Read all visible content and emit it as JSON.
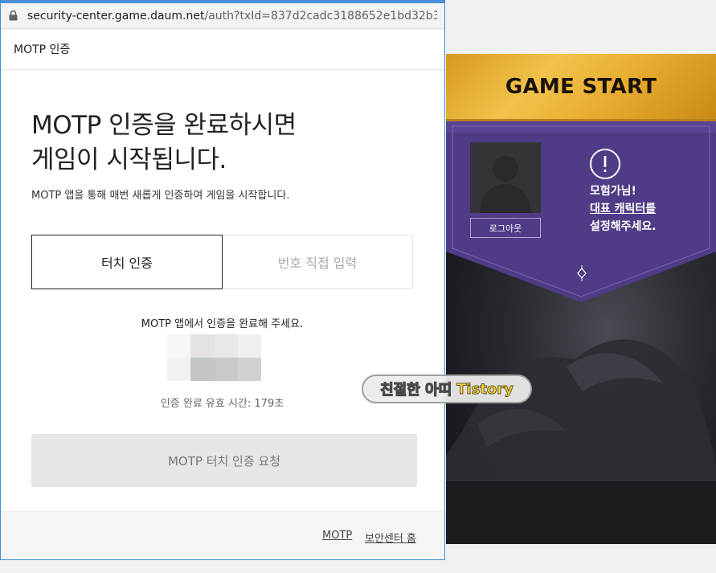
{
  "browser": {
    "url_host": "security-center.game.daum.net",
    "url_path": "/auth?txId=837d2cadc3188652e1bd32b3dcb8..."
  },
  "popup": {
    "window_title": "MOTP 인증",
    "heading_line1": "MOTP 인증을 완료하시면",
    "heading_line2": "게임이 시작됩니다.",
    "subtitle": "MOTP 앱을 통해 매번 새롭게 인증하여 게임을 시작합니다.",
    "tabs": [
      {
        "label": "터치 인증",
        "active": true
      },
      {
        "label": "번호 직접 입력",
        "active": false
      }
    ],
    "instruction": "MOTP 앱에서 인증을 완료해 주세요.",
    "validity": "인증 완료 유효 시간: 179초",
    "request_button": "MOTP 터치 인증 요청",
    "footer_links": [
      {
        "label": "MOTP"
      },
      {
        "label": "보안센터 홈"
      }
    ]
  },
  "game": {
    "start_label": "GAME START",
    "logout_label": "로그아웃",
    "notice_line1": "모험가님!",
    "notice_line2": "대표 캐릭터를",
    "notice_line3": "설정해주세요.",
    "colors": {
      "banner_gold": "#e8ae32",
      "banner_purple": "#4f3b86"
    }
  },
  "watermark": {
    "part1": "친절한 아띠",
    "part2": "Tistory"
  },
  "icons": [
    "lock-icon",
    "avatar-placeholder-icon",
    "alert-icon",
    "diamond-icon"
  ]
}
